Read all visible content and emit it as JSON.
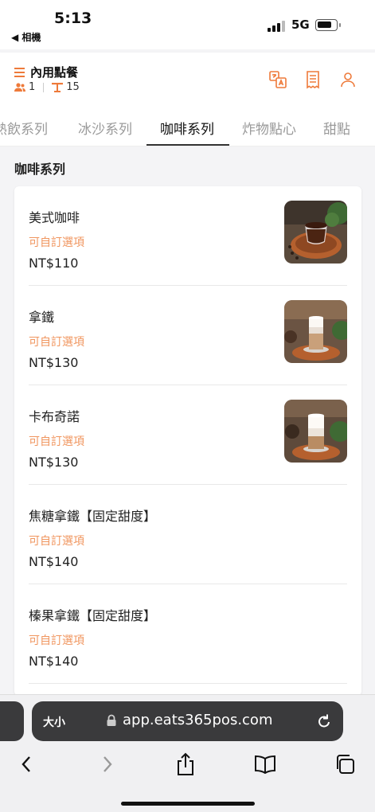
{
  "status_bar": {
    "time": "5:13",
    "back_label": "◀ 相機",
    "network": "5G"
  },
  "header": {
    "title": "內用點餐",
    "guests": "1",
    "table": "15",
    "icons": [
      "translate-icon",
      "receipt-icon",
      "user-icon"
    ]
  },
  "tabs": [
    {
      "label": "熱飲系列"
    },
    {
      "label": "冰沙系列"
    },
    {
      "label": "咖啡系列"
    },
    {
      "label": "炸物點心"
    },
    {
      "label": "甜點"
    }
  ],
  "section": {
    "title": "咖啡系列"
  },
  "items": [
    {
      "name": "美式咖啡",
      "option": "可自訂選項",
      "price": "NT$110"
    },
    {
      "name": "拿鐵",
      "option": "可自訂選項",
      "price": "NT$130"
    },
    {
      "name": "卡布奇諾",
      "option": "可自訂選項",
      "price": "NT$130"
    },
    {
      "name": "焦糖拿鐵【固定甜度】",
      "option": "可自訂選項",
      "price": "NT$140"
    },
    {
      "name": "榛果拿鐵【固定甜度】",
      "option": "可自訂選項",
      "price": "NT$140"
    }
  ],
  "browser": {
    "text_size_label": "大小",
    "url": "app.eats365pos.com"
  },
  "colors": {
    "accent": "#ee7a3a",
    "option_text": "#f0955e"
  }
}
